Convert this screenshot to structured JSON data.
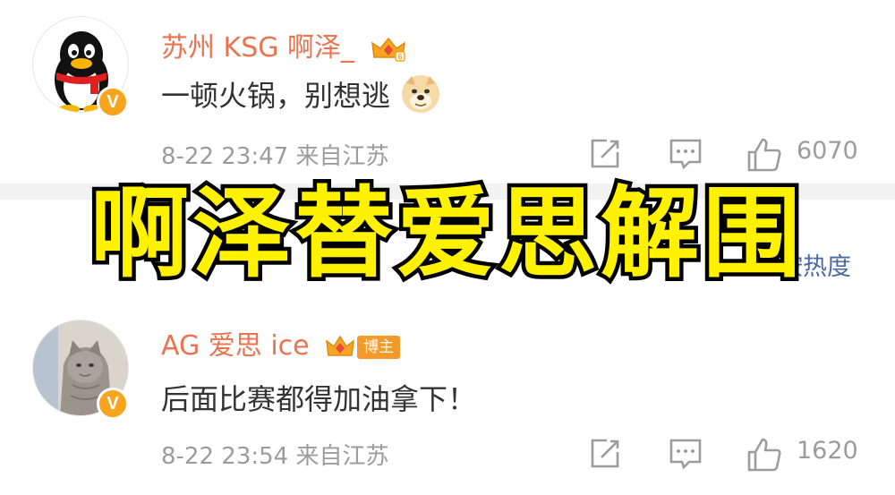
{
  "comments": [
    {
      "username": "苏州 KSG 啊泽_",
      "text": "一顿火锅，别想逃",
      "emoji": "doge-emoji",
      "time": "8-22 23:47",
      "source": "来自江苏",
      "likes": "6070",
      "avatar": "qq-penguin-avatar",
      "badge": "V"
    },
    {
      "username": "AG 爱思 ice",
      "tag": "博主",
      "text": "后面比赛都得加油拿下！",
      "time": "8-22 23:54",
      "source": "来自江苏",
      "likes": "1620",
      "avatar": "cat-photo-avatar",
      "badge": "V"
    }
  ],
  "sort": {
    "label": "按热度"
  },
  "overlay": {
    "caption": "啊泽替爱思解围"
  },
  "colors": {
    "username": "#eb7350",
    "badge": "#f7a51c",
    "caption_fill": "#fff200",
    "caption_stroke": "#000000",
    "meta": "#9c9c9c",
    "sort_link": "#4b6aa1"
  }
}
